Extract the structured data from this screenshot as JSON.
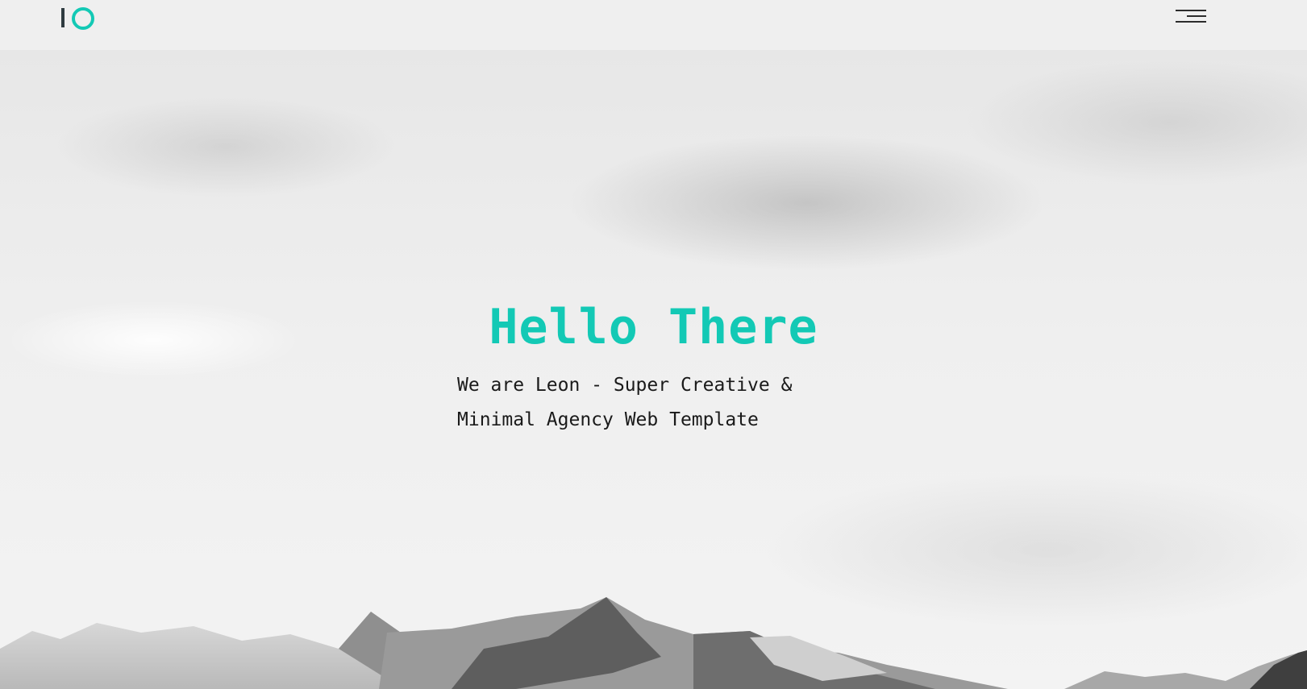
{
  "header": {
    "logo": {
      "bar_color": "#2f3b40",
      "ring_color": "#13c9b5",
      "icon": "logo-mark"
    },
    "menu": {
      "icon": "hamburger-menu-icon"
    }
  },
  "hero": {
    "title": "Hello There",
    "subtitle_line1": "We are Leon - Super Creative &",
    "subtitle_line2": "Minimal Agency Web Template",
    "accent_color": "#13c9b5",
    "background": "grayscale snowy mountain peaks under cloudy sky"
  }
}
